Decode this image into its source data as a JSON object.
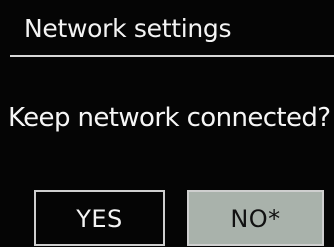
{
  "header": {
    "title": "Network settings"
  },
  "dialog": {
    "prompt": "Keep network connected?"
  },
  "buttons": {
    "yes_label": "YES",
    "no_label": "NO*"
  },
  "colors": {
    "background": "#050505",
    "text": "#f4f4f4",
    "selected_button_bg": "#a9b2ab",
    "selected_button_text": "#111111"
  }
}
